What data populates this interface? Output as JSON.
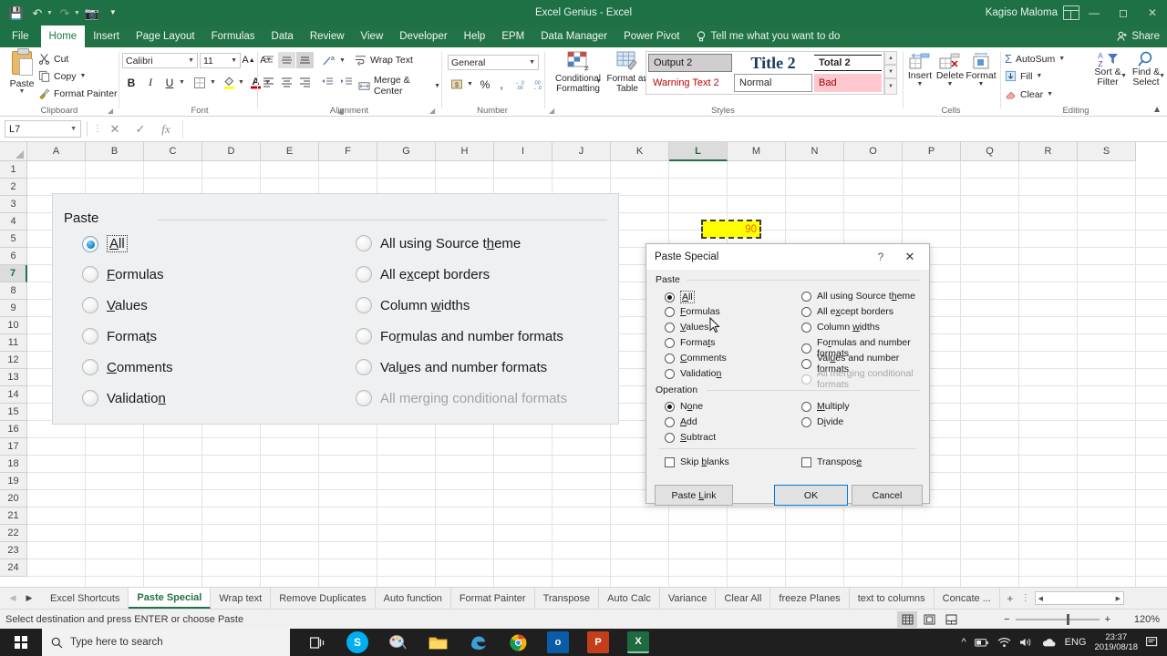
{
  "titlebar": {
    "document_title": "Excel Genius  -  Excel",
    "account_name": "Kagiso Maloma",
    "qat": [
      "save-icon",
      "undo-icon",
      "redo-icon",
      "camera-icon",
      "customize-qat-icon"
    ],
    "window_buttons": [
      "minimize",
      "restore",
      "close"
    ],
    "ribbon_display_options": "ribbon-display-options-icon"
  },
  "tabs": {
    "items": [
      {
        "label": "File",
        "active": false
      },
      {
        "label": "Home",
        "active": true
      },
      {
        "label": "Insert",
        "active": false
      },
      {
        "label": "Page Layout",
        "active": false
      },
      {
        "label": "Formulas",
        "active": false
      },
      {
        "label": "Data",
        "active": false
      },
      {
        "label": "Review",
        "active": false
      },
      {
        "label": "View",
        "active": false
      },
      {
        "label": "Developer",
        "active": false
      },
      {
        "label": "Help",
        "active": false
      },
      {
        "label": "EPM",
        "active": false
      },
      {
        "label": "Data Manager",
        "active": false
      },
      {
        "label": "Power Pivot",
        "active": false
      }
    ],
    "tell_me": "Tell me what you want to do",
    "share": "Share"
  },
  "ribbon": {
    "clipboard": {
      "group_label": "Clipboard",
      "paste": "Paste",
      "cut": "Cut",
      "copy": "Copy",
      "format_painter": "Format Painter"
    },
    "font": {
      "group_label": "Font",
      "font_name": "Calibri",
      "font_size": "11",
      "bold": "B",
      "italic": "I",
      "underline": "U"
    },
    "alignment": {
      "group_label": "Alignment",
      "wrap_text": "Wrap Text",
      "merge_center": "Merge & Center"
    },
    "number": {
      "group_label": "Number",
      "format": "General",
      "percent": "%",
      "comma": ","
    },
    "styles": {
      "group_label": "Styles",
      "conditional_formatting": "Conditional Formatting",
      "format_as_table": "Format as Table",
      "gallery": [
        {
          "label": "Output 2",
          "style": "output"
        },
        {
          "label": "Title 2",
          "style": "title"
        },
        {
          "label": "Total 2",
          "style": "total"
        },
        {
          "label": "Warning Text 2",
          "style": "warning"
        },
        {
          "label": "Normal",
          "style": "normal"
        },
        {
          "label": "Bad",
          "style": "bad"
        }
      ]
    },
    "cells": {
      "group_label": "Cells",
      "insert": "Insert",
      "delete": "Delete",
      "format": "Format"
    },
    "editing": {
      "group_label": "Editing",
      "autosum": "AutoSum",
      "fill": "Fill",
      "clear": "Clear",
      "sort_filter": "Sort & Filter",
      "find_select": "Find & Select"
    }
  },
  "formula_bar": {
    "name_box": "L7",
    "formula": "",
    "cancel_icon": "cancel-icon",
    "enter_icon": "enter-icon",
    "function_icon": "insert-function-icon"
  },
  "grid": {
    "columns": [
      "A",
      "B",
      "C",
      "D",
      "E",
      "F",
      "G",
      "H",
      "I",
      "J",
      "K",
      "L",
      "M",
      "N",
      "O",
      "P",
      "Q",
      "R",
      "S"
    ],
    "selected_column": "L",
    "rows": [
      "1",
      "2",
      "3",
      "4",
      "5",
      "6",
      "7",
      "8",
      "9",
      "10",
      "11",
      "12",
      "13",
      "14",
      "15",
      "16",
      "17",
      "18",
      "19",
      "20",
      "21",
      "22",
      "23",
      "24"
    ],
    "selected_row": "7",
    "copy_cell": {
      "address": "L7",
      "value": "90"
    }
  },
  "paste_panel": {
    "legend": "Paste",
    "left_options": [
      {
        "label": "All",
        "accel": "A",
        "selected": true,
        "disabled": false,
        "focused": true
      },
      {
        "label": "Formulas",
        "accel": "F",
        "selected": false,
        "disabled": false,
        "focused": false
      },
      {
        "label": "Values",
        "accel": "V",
        "selected": false,
        "disabled": false,
        "focused": false
      },
      {
        "label": "Formats",
        "accel": "t",
        "selected": false,
        "disabled": false,
        "focused": false
      },
      {
        "label": "Comments",
        "accel": "C",
        "selected": false,
        "disabled": false,
        "focused": false
      },
      {
        "label": "Validation",
        "accel": "n",
        "selected": false,
        "disabled": false,
        "focused": false
      }
    ],
    "right_options": [
      {
        "label": "All using Source theme",
        "accel": "h",
        "selected": false,
        "disabled": false
      },
      {
        "label": "All except borders",
        "accel": "x",
        "selected": false,
        "disabled": false
      },
      {
        "label": "Column widths",
        "accel": "w",
        "selected": false,
        "disabled": false
      },
      {
        "label": "Formulas and number formats",
        "accel": "r",
        "selected": false,
        "disabled": false
      },
      {
        "label": "Values and number formats",
        "accel": "u",
        "selected": false,
        "disabled": false
      },
      {
        "label": "All merging conditional formats",
        "accel": "",
        "selected": false,
        "disabled": true
      }
    ]
  },
  "dialog": {
    "title": "Paste Special",
    "help_icon": "help-icon",
    "close_icon": "close-icon",
    "paste_legend": "Paste",
    "paste_left": [
      {
        "label": "All",
        "selected": true,
        "disabled": false,
        "focused": true
      },
      {
        "label": "Formulas",
        "selected": false,
        "disabled": false,
        "focused": false
      },
      {
        "label": "Values",
        "selected": false,
        "disabled": false,
        "focused": false
      },
      {
        "label": "Formats",
        "selected": false,
        "disabled": false,
        "focused": false
      },
      {
        "label": "Comments",
        "selected": false,
        "disabled": false,
        "focused": false
      },
      {
        "label": "Validation",
        "selected": false,
        "disabled": false,
        "focused": false
      }
    ],
    "paste_right": [
      {
        "label": "All using Source theme",
        "selected": false,
        "disabled": false
      },
      {
        "label": "All except borders",
        "selected": false,
        "disabled": false
      },
      {
        "label": "Column widths",
        "selected": false,
        "disabled": false
      },
      {
        "label": "Formulas and number formats",
        "selected": false,
        "disabled": false
      },
      {
        "label": "Values and number formats",
        "selected": false,
        "disabled": false
      },
      {
        "label": "All merging conditional formats",
        "selected": false,
        "disabled": true
      }
    ],
    "operation_legend": "Operation",
    "operation_left": [
      {
        "label": "None",
        "selected": true
      },
      {
        "label": "Add",
        "selected": false
      },
      {
        "label": "Subtract",
        "selected": false
      }
    ],
    "operation_right": [
      {
        "label": "Multiply",
        "selected": false
      },
      {
        "label": "Divide",
        "selected": false
      }
    ],
    "checkboxes": [
      {
        "label": "Skip blanks",
        "checked": false
      },
      {
        "label": "Transpose",
        "checked": false
      }
    ],
    "buttons": {
      "paste_link": "Paste Link",
      "ok": "OK",
      "cancel": "Cancel"
    }
  },
  "sheet_tabs": {
    "items": [
      {
        "label": "Excel Shortcuts",
        "active": false
      },
      {
        "label": "Paste Special",
        "active": true
      },
      {
        "label": "Wrap text",
        "active": false
      },
      {
        "label": "Remove Duplicates",
        "active": false
      },
      {
        "label": "Auto function",
        "active": false
      },
      {
        "label": "Format Painter",
        "active": false
      },
      {
        "label": "Transpose",
        "active": false
      },
      {
        "label": "Auto Calc",
        "active": false
      },
      {
        "label": "Variance",
        "active": false
      },
      {
        "label": "Clear All",
        "active": false
      },
      {
        "label": "freeze Planes",
        "active": false
      },
      {
        "label": "text to columns",
        "active": false
      },
      {
        "label": "Concate ...",
        "active": false
      }
    ],
    "add_sheet": "+"
  },
  "status_bar": {
    "message": "Select destination and press ENTER or choose Paste",
    "zoom_level": "120%",
    "view_buttons": [
      "normal-view-icon",
      "page-layout-view-icon",
      "page-break-preview-icon"
    ]
  },
  "taskbar": {
    "search_placeholder": "Type here to search",
    "apps": [
      "task-view-icon",
      "skype-icon",
      "paint-icon",
      "file-explorer-icon",
      "edge-icon",
      "chrome-icon",
      "outlook-icon",
      "powerpoint-icon",
      "excel-icon"
    ],
    "tray": [
      "battery-icon",
      "wifi-icon",
      "volume-icon",
      "onedrive-icon"
    ],
    "language": "ENG",
    "time": "23:37",
    "date": "2019/08/18",
    "notification_icon": "action-center-icon"
  }
}
